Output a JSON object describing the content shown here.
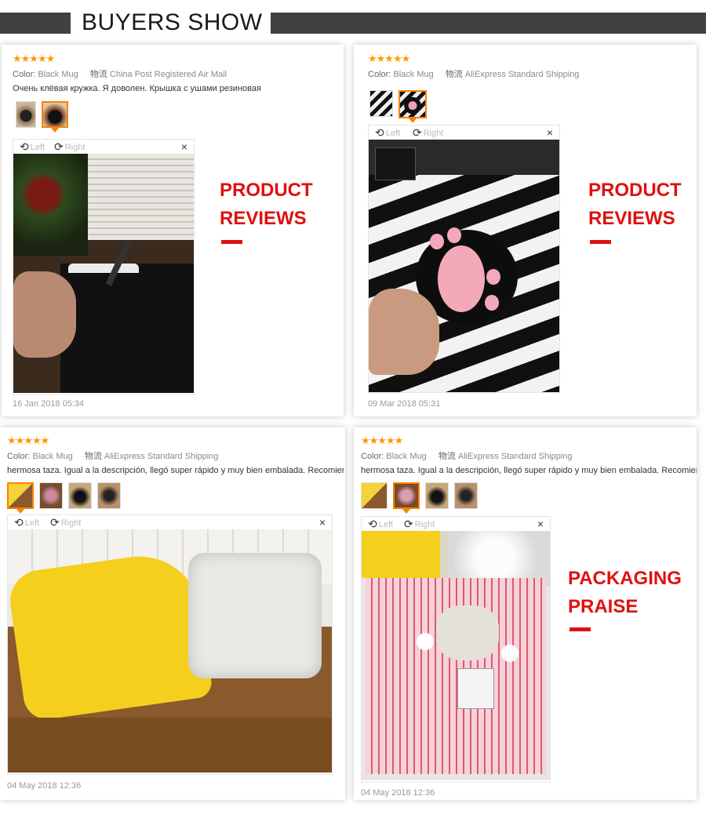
{
  "header": {
    "title": "BUYERS SHOW"
  },
  "reviews": [
    {
      "stars": "★★★★★",
      "color_label": "Color:",
      "color_value": "Black Mug",
      "shipping_label": "物流",
      "shipping_value": "China Post Registered Air Mail",
      "text": "Очень клёвая кружка. Я доволен. Крышка с ушами резиновая",
      "left_label": "Left",
      "right_label": "Right",
      "close_icon": "×",
      "date": "16 Jan 2018 05:34",
      "callout_line1": "PRODUCT",
      "callout_line2": "REVIEWS"
    },
    {
      "stars": "★★★★★",
      "color_label": "Color:",
      "color_value": "Black Mug",
      "shipping_label": "物流",
      "shipping_value": "AliExpress Standard Shipping",
      "text": "",
      "left_label": "Left",
      "right_label": "Right",
      "close_icon": "×",
      "date": "09 Mar 2018 05:31",
      "callout_line1": "PRODUCT",
      "callout_line2": "REVIEWS"
    },
    {
      "stars": "★★★★★",
      "color_label": "Color:",
      "color_value": "Black Mug",
      "shipping_label": "物流",
      "shipping_value": "AliExpress Standard Shipping",
      "text": "hermosa taza. Igual a la descripción, llegó super rápido y muy bien embalada. Recomiendo",
      "left_label": "Left",
      "right_label": "Right",
      "close_icon": "×",
      "date": "04 May 2018 12:36"
    },
    {
      "stars": "★★★★★",
      "color_label": "Color:",
      "color_value": "Black Mug",
      "shipping_label": "物流",
      "shipping_value": "AliExpress Standard Shipping",
      "text": "hermosa taza. Igual a la descripción, llegó super rápido y muy bien embalada. Recomiendo",
      "left_label": "Left",
      "right_label": "Right",
      "close_icon": "×",
      "date": "04 May 2018 12:36",
      "callout_line1": "PACKAGING",
      "callout_line2": "PRAISE"
    }
  ],
  "colors": {
    "accent_red": "#e01010",
    "star_orange": "#ff9800",
    "banner_gray": "#414141",
    "selected_thumb": "#ff8000"
  },
  "icons": {
    "rotate_left": "rotate-left-icon",
    "rotate_right": "rotate-right-icon",
    "close": "close-icon",
    "star": "star-icon"
  }
}
